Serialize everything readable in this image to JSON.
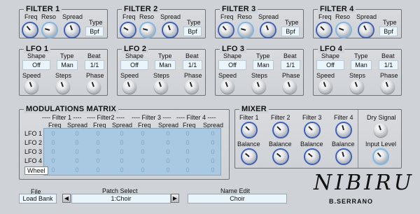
{
  "filters": [
    {
      "title": "FILTER 1",
      "freq": "Freq",
      "reso": "Reso",
      "spread": "Spread",
      "type_label": "Type",
      "type_value": "Bpf"
    },
    {
      "title": "FILTER 2",
      "freq": "Freq",
      "reso": "Reso",
      "spread": "Spread",
      "type_label": "Type",
      "type_value": "Bpf"
    },
    {
      "title": "FILTER 3",
      "freq": "Freq",
      "reso": "Reso",
      "spread": "Spread",
      "type_label": "Type",
      "type_value": "Bpf"
    },
    {
      "title": "FILTER 4",
      "freq": "Freq",
      "reso": "Reso",
      "spread": "Spread",
      "type_label": "Type",
      "type_value": "Bpf"
    }
  ],
  "lfos": [
    {
      "title": "LFO 1",
      "shape_label": "Shape",
      "type_label": "Type",
      "beat_label": "Beat",
      "shape": "Off",
      "type": "Man",
      "beat": "1/1",
      "speed": "Speed",
      "steps": "Steps",
      "phase": "Phase"
    },
    {
      "title": "LFO 2",
      "shape_label": "Shape",
      "type_label": "Type",
      "beat_label": "Beat",
      "shape": "Off",
      "type": "Man",
      "beat": "1/1",
      "speed": "Speed",
      "steps": "Steps",
      "phase": "Phase"
    },
    {
      "title": "LFO 3",
      "shape_label": "Shape",
      "type_label": "Type",
      "beat_label": "Beat",
      "shape": "Off",
      "type": "Man",
      "beat": "1/1",
      "speed": "Speed",
      "steps": "Steps",
      "phase": "Phase"
    },
    {
      "title": "LFO 4",
      "shape_label": "Shape",
      "type_label": "Type",
      "beat_label": "Beat",
      "shape": "Off",
      "type": "Man",
      "beat": "1/1",
      "speed": "Speed",
      "steps": "Steps",
      "phase": "Phase"
    }
  ],
  "matrix": {
    "title": "MODULATIONS MATRIX",
    "groups": [
      "---- Filter 1 ----",
      "---- Filter2 ----",
      "---- Filter 3 ----",
      "---- Filter 4 ----"
    ],
    "cols": [
      "Freq",
      "Spread",
      "Freq",
      "Spread",
      "Freq",
      "Spread",
      "Freq",
      "Spread"
    ],
    "rows": [
      "LFO 1",
      "LFO 2",
      "LFO 3",
      "LFO 4",
      "Wheel"
    ],
    "cell_value": "0"
  },
  "mixer": {
    "title": "MIXER",
    "filters": [
      "Filter 1",
      "Filter 2",
      "Filter 3",
      "Filter 4"
    ],
    "balance": "Balance",
    "dry": "Dry Signal",
    "input": "Input Level"
  },
  "bottom": {
    "file_label": "File",
    "file_value": "Load Bank",
    "patch_label": "Patch Select",
    "patch_value": "1:Choir",
    "name_label": "Name Edit",
    "name_value": "Choir",
    "prev": "◀",
    "next": "▶"
  },
  "brand": {
    "logo": "NIBIRU",
    "author": "B.SERRANO"
  }
}
